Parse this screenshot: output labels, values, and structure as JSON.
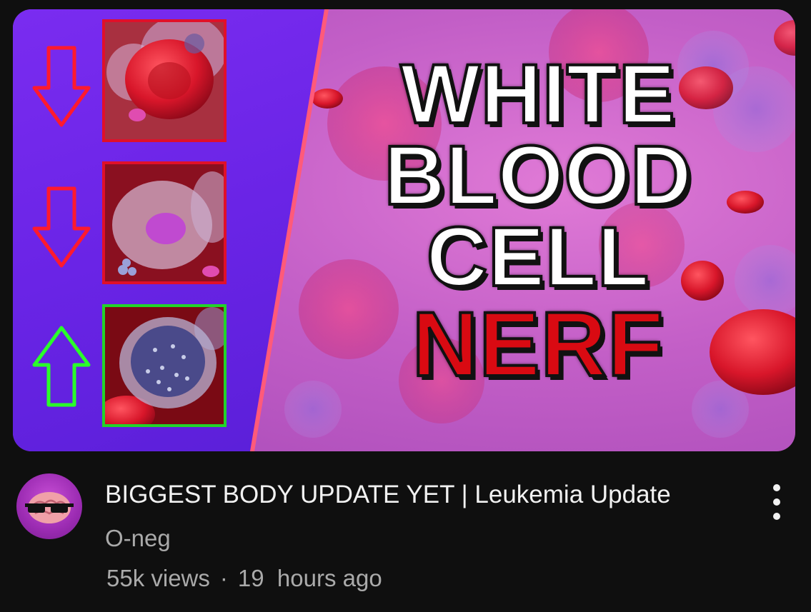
{
  "thumbnail": {
    "headline": {
      "line1": "WHITE",
      "line2": "BLOOD",
      "line3": "CELL",
      "line4": "NERF"
    },
    "colors": {
      "purple_panel": "#6a24e6",
      "red_frame": "#e0102a",
      "green_frame": "#22d42a",
      "nerf_red": "#d90a12"
    },
    "indicators": [
      {
        "icon": "down-arrow-red-icon",
        "frame": "red"
      },
      {
        "icon": "down-arrow-red-icon",
        "frame": "red"
      },
      {
        "icon": "up-arrow-green-icon",
        "frame": "green"
      }
    ]
  },
  "video": {
    "title": "BIGGEST BODY UPDATE YET | Leukemia Update",
    "channel": "O-neg",
    "views": "55k views",
    "separator": "·",
    "age": "19  hours ago",
    "menu_icon": "more-vertical-icon",
    "avatar_icon": "brain-with-sunglasses-icon"
  }
}
